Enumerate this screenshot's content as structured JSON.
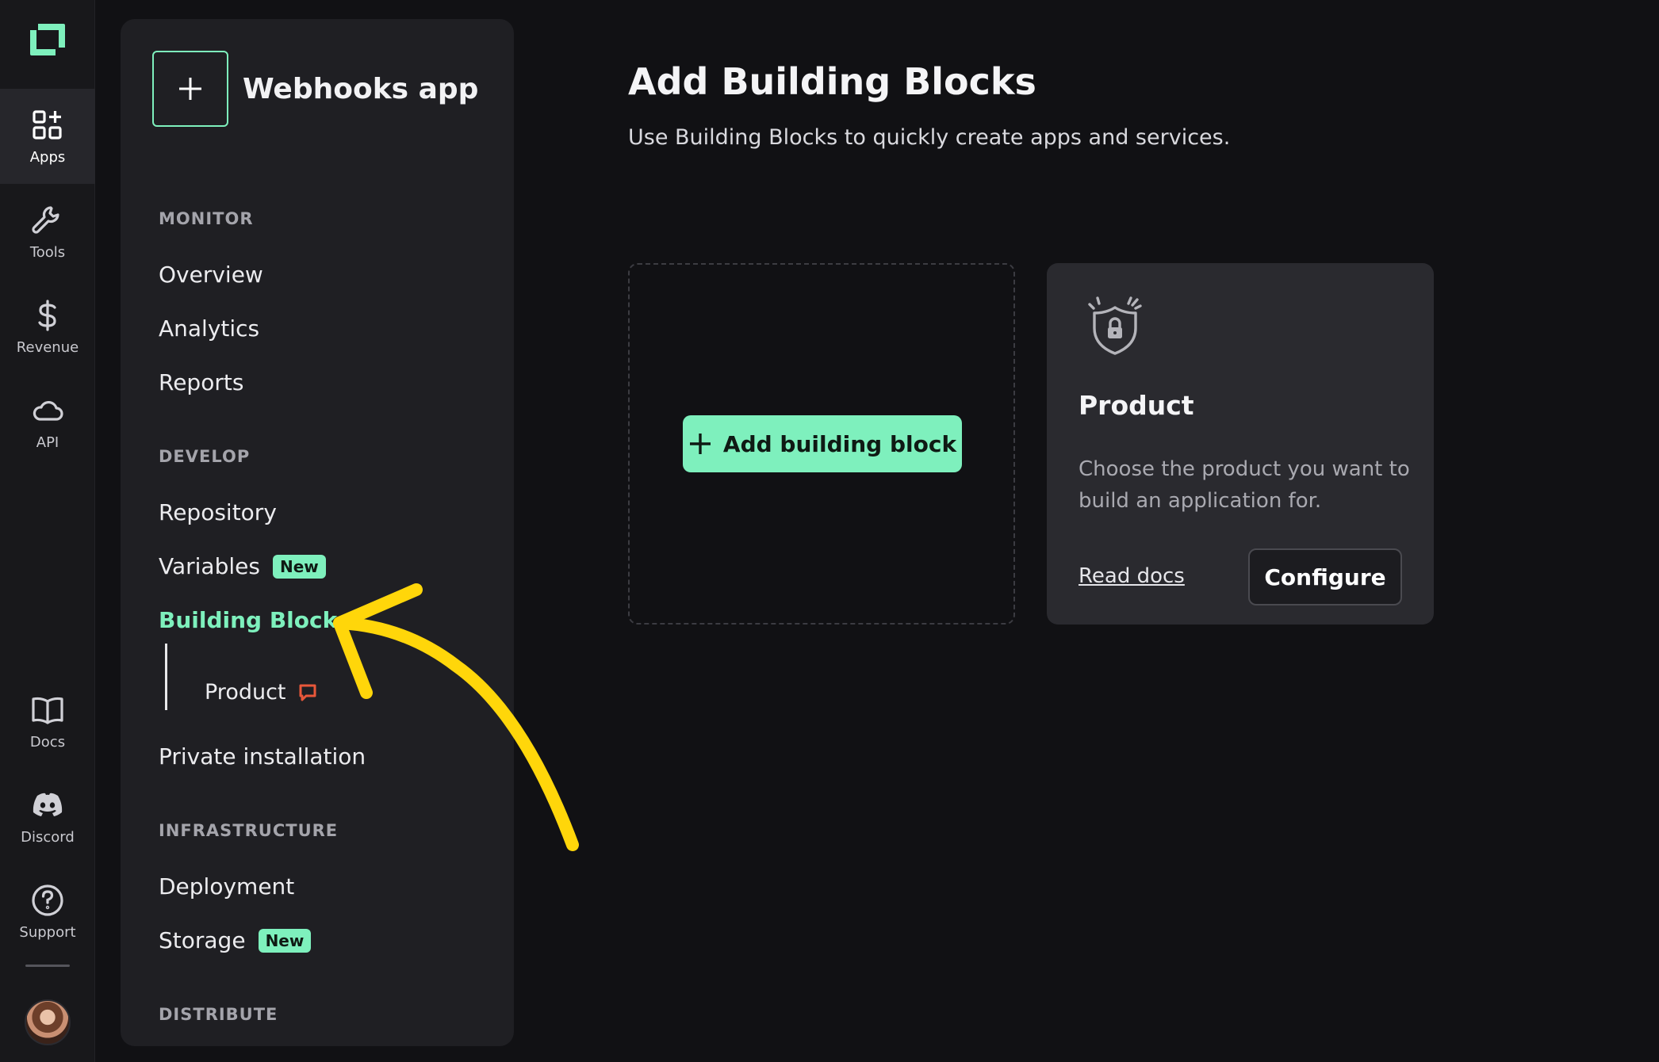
{
  "rail": {
    "items": [
      {
        "label": "Apps",
        "icon": "apps-icon"
      },
      {
        "label": "Tools",
        "icon": "wrench-icon"
      },
      {
        "label": "Revenue",
        "icon": "dollar-icon"
      },
      {
        "label": "API",
        "icon": "cloud-icon"
      },
      {
        "label": "Docs",
        "icon": "book-icon"
      },
      {
        "label": "Discord",
        "icon": "discord-icon"
      },
      {
        "label": "Support",
        "icon": "help-icon"
      }
    ],
    "active": "Apps"
  },
  "sidebar": {
    "app_title": "Webhooks app",
    "sections": {
      "monitor": "MONITOR",
      "develop": "DEVELOP",
      "infrastructure": "INFRASTRUCTURE",
      "distribute": "DISTRIBUTE"
    },
    "items": {
      "overview": "Overview",
      "analytics": "Analytics",
      "reports": "Reports",
      "repository": "Repository",
      "variables": "Variables",
      "building_blocks": "Building Blocks",
      "product": "Product",
      "private_installation": "Private installation",
      "deployment": "Deployment",
      "storage": "Storage"
    },
    "badges": {
      "variables": "New",
      "storage": "New"
    }
  },
  "main": {
    "title": "Add Building Blocks",
    "subtitle": "Use Building Blocks to quickly create apps and services.",
    "add_button_label": "Add building block",
    "product_card": {
      "title": "Product",
      "description": "Choose the product you want to build an application for.",
      "read_docs_label": "Read docs",
      "configure_label": "Configure"
    }
  },
  "colors": {
    "accent": "#7ef0bd",
    "background": "#111114",
    "sidebar": "#1f1f23",
    "annotation_arrow": "#ffd60a",
    "notification": "#e8573a"
  }
}
